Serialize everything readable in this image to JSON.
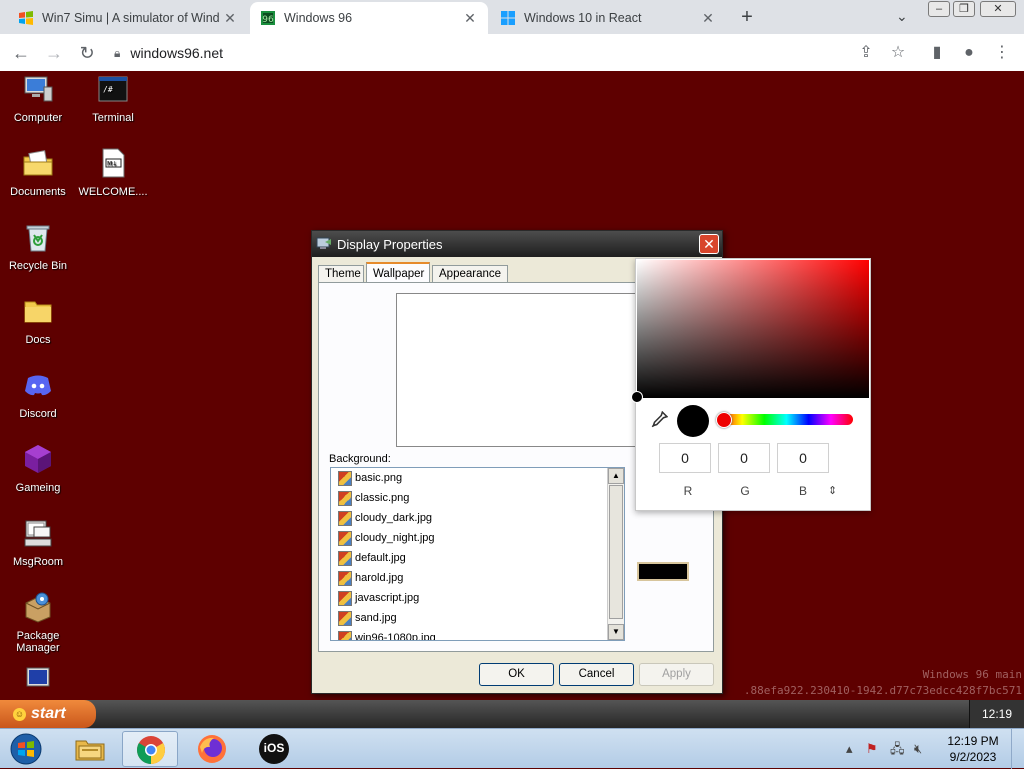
{
  "browser": {
    "tabs": [
      {
        "title": "Win7 Simu | A simulator of Wind",
        "active": false
      },
      {
        "title": "Windows 96",
        "active": true
      },
      {
        "title": "Windows 10 in React",
        "active": false
      }
    ],
    "url": "windows96.net"
  },
  "desktop": {
    "icons": [
      {
        "label": "Computer",
        "icon": "computer-icon"
      },
      {
        "label": "Terminal",
        "icon": "terminal-icon"
      },
      {
        "label": "Documents",
        "icon": "documents-icon"
      },
      {
        "label": "WELCOME....",
        "icon": "markdown-file-icon"
      },
      {
        "label": "Recycle Bin",
        "icon": "recycle-bin-icon"
      },
      {
        "label": "Docs",
        "icon": "folder-icon"
      },
      {
        "label": "Discord",
        "icon": "discord-icon"
      },
      {
        "label": "Gameing",
        "icon": "game-icon"
      },
      {
        "label": "MsgRoom",
        "icon": "msgroom-icon"
      },
      {
        "label": "Package Manager",
        "icon": "package-manager-icon"
      }
    ],
    "background_color": "#5e0000",
    "watermark_line1": "Windows 96 main",
    "watermark_line2": ".88efa922.230410-1942.d77c73edcc428f7bc571"
  },
  "dialog": {
    "title": "Display Properties",
    "tabs": [
      "Theme",
      "Wallpaper",
      "Appearance"
    ],
    "active_tab": "Wallpaper",
    "background_label": "Background:",
    "files": [
      "basic.png",
      "classic.png",
      "cloudy_dark.jpg",
      "cloudy_night.jpg",
      "default.jpg",
      "harold.jpg",
      "javascript.jpg",
      "sand.jpg",
      "win96-1080p.jpg"
    ],
    "buttons": {
      "ok": "OK",
      "cancel": "Cancel",
      "apply": "Apply"
    }
  },
  "color_picker": {
    "r": "0",
    "g": "0",
    "b": "0",
    "r_label": "R",
    "g_label": "G",
    "b_label": "B",
    "selected_color": "#000000",
    "hue_color": "#ff0000"
  },
  "w96_taskbar": {
    "start_label": "start",
    "clock": "12:19"
  },
  "os_taskbar": {
    "time": "12:19 PM",
    "date": "9/2/2023",
    "ios_label": "iOS"
  }
}
